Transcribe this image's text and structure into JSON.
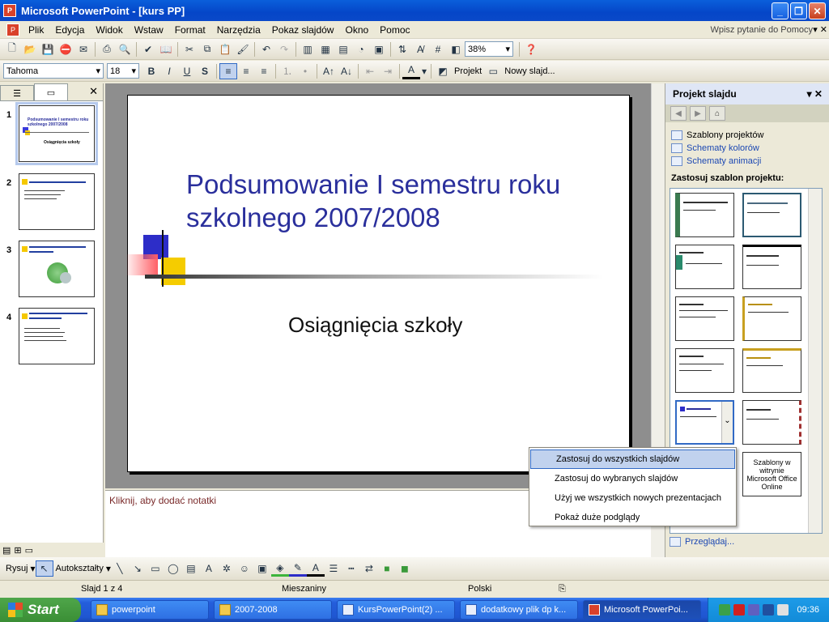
{
  "window": {
    "title": "Microsoft PowerPoint - [kurs PP]"
  },
  "menu": {
    "items": [
      "Plik",
      "Edycja",
      "Widok",
      "Wstaw",
      "Format",
      "Narzędzia",
      "Pokaz slajdów",
      "Okno",
      "Pomoc"
    ],
    "ask_placeholder": "Wpisz pytanie do Pomocy"
  },
  "toolbar": {
    "zoom": "38%",
    "font": "Tahoma",
    "size": "18",
    "design": "Projekt",
    "new_slide": "Nowy slajd..."
  },
  "slides_panel": {
    "tab_outline_icon": "outline-icon",
    "tab_slides_icon": "slides-icon",
    "thumbs": [
      {
        "num": "1",
        "title": "Podsumowanie I semestru roku szkolnego 2007/2008",
        "sub": "Osiągnięcia szkoły"
      },
      {
        "num": "2",
        "title": "Podsumowanie ...",
        "sub": ""
      },
      {
        "num": "3",
        "title": "Każdy ułaja mod bok pracprob i robi...",
        "sub": ""
      },
      {
        "num": "4",
        "title": "Staraj się, aby w danym... było jak najwięcej",
        "sub": ""
      }
    ]
  },
  "slide": {
    "title": "Podsumowanie I semestru roku szkolnego 2007/2008",
    "subtitle": "Osiągnięcia szkoły"
  },
  "notes": {
    "placeholder": "Kliknij, aby dodać notatki"
  },
  "taskpane": {
    "title": "Projekt slajdu",
    "links": [
      "Szablony projektów",
      "Schematy kolorów",
      "Schematy animacji"
    ],
    "section": "Zastosuj szablon projektu:",
    "online": "Szablony w witrynie Microsoft Office Online",
    "browse": "Przeglądaj..."
  },
  "context_menu": {
    "items": [
      "Zastosuj do wszystkich slajdów",
      "Zastosuj do wybranych slajdów",
      "Użyj we wszystkich nowych prezentacjach",
      "Pokaż duże podglądy"
    ]
  },
  "drawing": {
    "draw": "Rysuj",
    "autoshapes": "Autokształty"
  },
  "status": {
    "slide": "Slajd 1 z 4",
    "design": "Mieszaniny",
    "language": "Polski"
  },
  "taskbar": {
    "start": "Start",
    "buttons": [
      "powerpoint",
      "2007-2008",
      "KursPowerPoint(2) ...",
      "dodatkowy plik dp k...",
      "Microsoft PowerPoi..."
    ],
    "clock": "09:36"
  },
  "colors": {
    "title_blue": "#2a2f9c",
    "xp_blue": "#0546c8"
  }
}
